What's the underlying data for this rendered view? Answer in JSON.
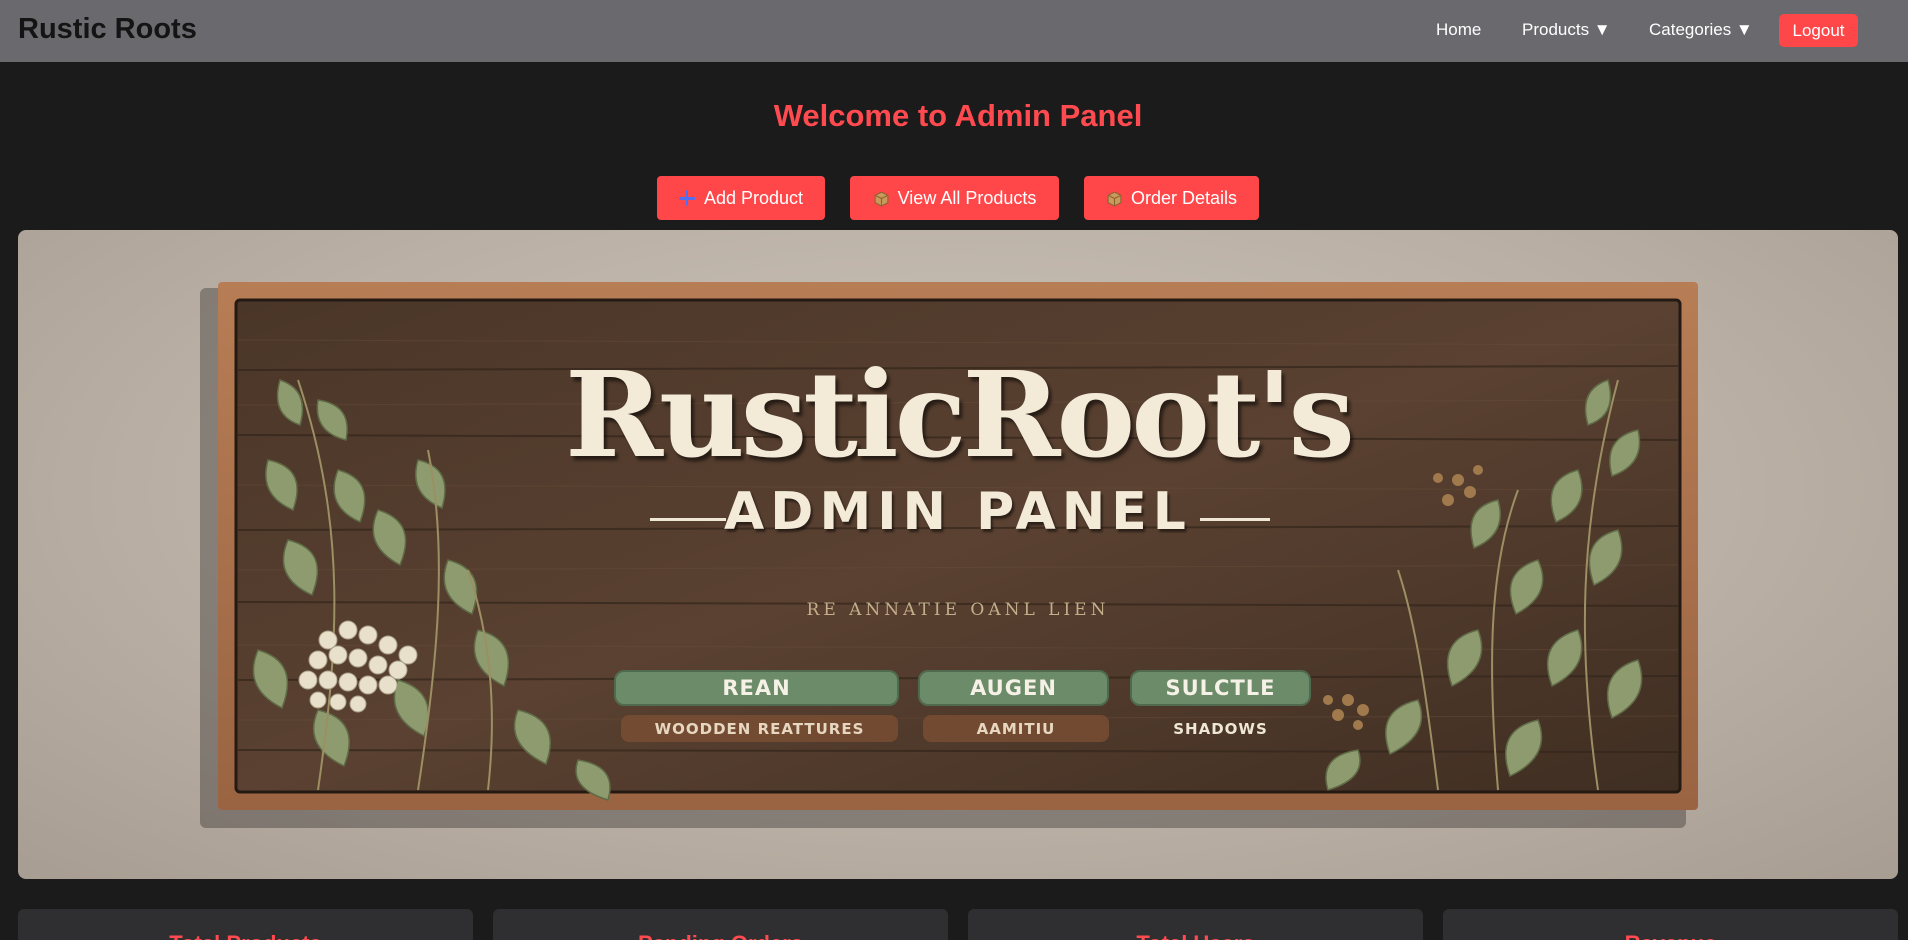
{
  "navbar": {
    "brand": "Rustic Roots",
    "links": {
      "home": "Home",
      "products": "Products ▼",
      "categories": "Categories ▼"
    },
    "logout": "Logout"
  },
  "main": {
    "title": "Welcome to Admin Panel",
    "actions": {
      "add_product": "Add Product",
      "view_all_products": "View All Products",
      "order_details": "Order Details"
    }
  },
  "banner": {
    "title": "RusticRoot's",
    "subtitle": "ADMIN PANEL",
    "tagline": "RE ANNATIE OANL LIEN",
    "pills": [
      "REAN",
      "AUGEN",
      "SULCTLE"
    ],
    "pill_subs": [
      "WOODDEN REATTURES",
      "AAMITIU",
      "SHADOWS"
    ]
  },
  "stats": {
    "cards": [
      "Total Products",
      "Pending Orders",
      "Total Users",
      "Revenue"
    ]
  },
  "colors": {
    "accent": "#ff474a",
    "navbar": "#6a696e",
    "background": "#1b1b1b",
    "card": "#2f2f31"
  },
  "icons": {
    "add_product": "plus-icon",
    "view_all_products": "package-icon",
    "order_details": "package-icon"
  }
}
